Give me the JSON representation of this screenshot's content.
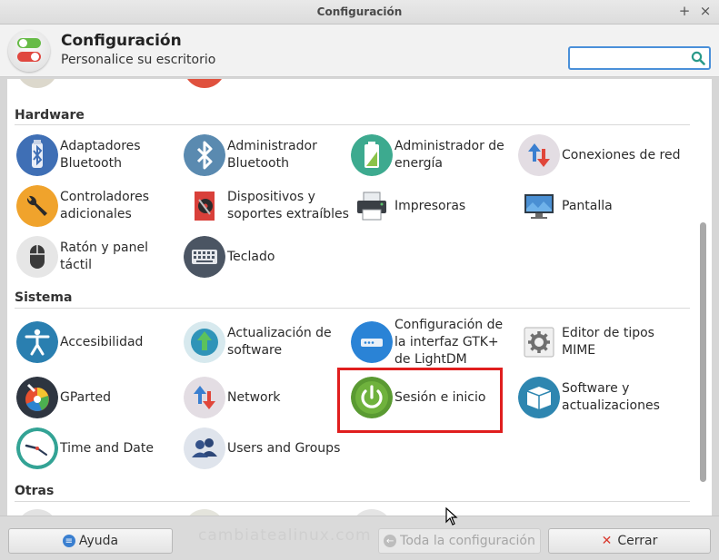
{
  "window": {
    "title": "Configuración",
    "maximize_glyph": "+",
    "close_glyph": "×"
  },
  "header": {
    "title": "Configuración",
    "subtitle": "Personalice su escritorio",
    "app_icon": "settings-toggles-icon",
    "search": {
      "value": "",
      "placeholder": "",
      "icon": "search-icon"
    }
  },
  "sections": {
    "hardware": {
      "title": "Hardware",
      "items": [
        {
          "label": "Adaptadores Bluetooth",
          "icon": "bluetooth-adapter-icon"
        },
        {
          "label": "Administrador Bluetooth",
          "icon": "bluetooth-icon"
        },
        {
          "label": "Administrador de energía",
          "icon": "battery-icon"
        },
        {
          "label": "Conexiones de red",
          "icon": "network-arrows-icon"
        },
        {
          "label": "Controladores adicionales",
          "icon": "wrench-icon"
        },
        {
          "label": "Dispositivos y soportes extraíbles",
          "icon": "media-disc-icon"
        },
        {
          "label": "Impresoras",
          "icon": "printer-icon"
        },
        {
          "label": "Pantalla",
          "icon": "monitor-icon"
        },
        {
          "label": "Ratón y panel táctil",
          "icon": "mouse-icon"
        },
        {
          "label": "Teclado",
          "icon": "keyboard-icon"
        }
      ]
    },
    "sistema": {
      "title": "Sistema",
      "items": [
        {
          "label": "Accesibilidad",
          "icon": "accessibility-icon"
        },
        {
          "label": "Actualización de software",
          "icon": "software-update-icon"
        },
        {
          "label": "Configuración de la interfaz GTK+ de LightDM",
          "icon": "lightdm-icon"
        },
        {
          "label": "Editor de tipos MIME",
          "icon": "gear-icon"
        },
        {
          "label": "GParted",
          "icon": "gparted-icon"
        },
        {
          "label": "Network",
          "icon": "network-arrows-icon"
        },
        {
          "label": "Sesión e inicio",
          "icon": "power-icon"
        },
        {
          "label": "Software y actualizaciones",
          "icon": "package-box-icon"
        },
        {
          "label": "Time and Date",
          "icon": "clock-icon"
        },
        {
          "label": "Users and Groups",
          "icon": "users-icon"
        }
      ]
    },
    "otras": {
      "title": "Otras"
    }
  },
  "footer": {
    "help_label": "Ayuda",
    "all_settings_label": "Toda la configuración",
    "all_settings_enabled": false,
    "close_label": "Cerrar",
    "watermark": "cambiatealinux.com"
  },
  "colors": {
    "highlight": "#e01e1e",
    "search_focus": "#4a90d9"
  }
}
